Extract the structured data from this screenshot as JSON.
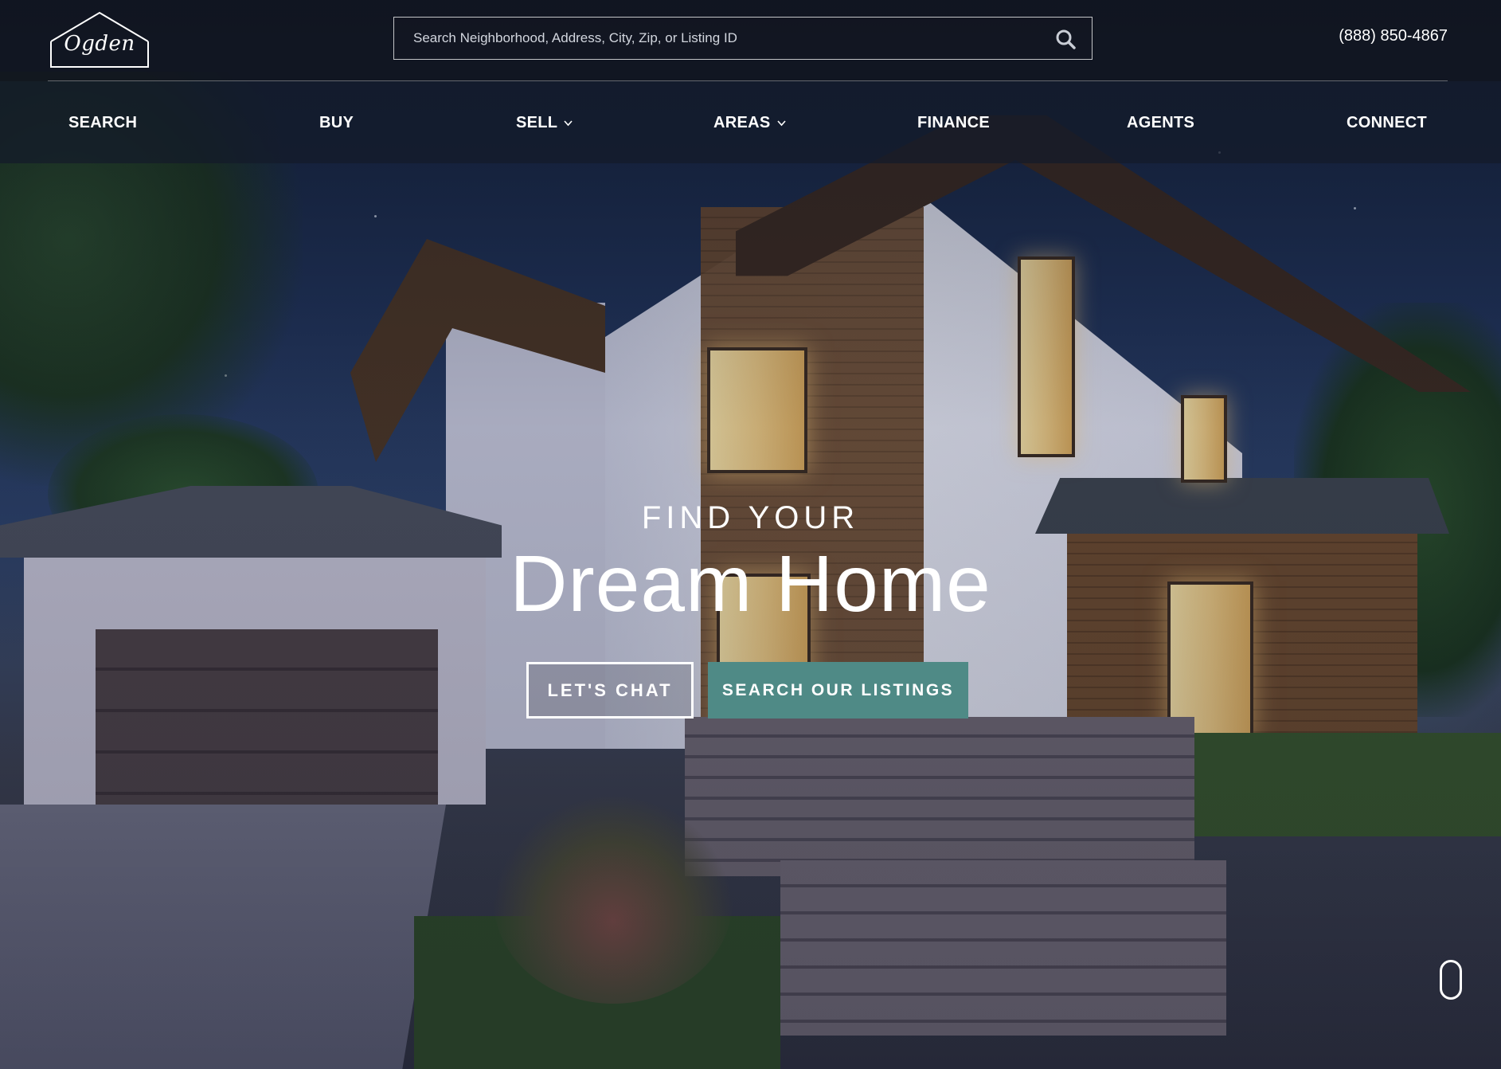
{
  "header": {
    "logo_text": "Ogden",
    "search": {
      "placeholder": "Search Neighborhood, Address, City, Zip, or Listing ID"
    },
    "phone": "(888) 850-4867"
  },
  "nav": {
    "items": [
      {
        "label": "SEARCH",
        "has_dropdown": false
      },
      {
        "label": "BUY",
        "has_dropdown": false
      },
      {
        "label": "SELL",
        "has_dropdown": true
      },
      {
        "label": "AREAS",
        "has_dropdown": true
      },
      {
        "label": "FINANCE",
        "has_dropdown": false
      },
      {
        "label": "AGENTS",
        "has_dropdown": false
      },
      {
        "label": "CONNECT",
        "has_dropdown": false
      }
    ]
  },
  "hero": {
    "kicker": "FIND YOUR",
    "headline": "Dream Home",
    "primary_button": "LET'S CHAT",
    "secondary_button": "SEARCH OUR LISTINGS"
  },
  "colors": {
    "accent": "#4f8a86",
    "header_bg": "#11151e",
    "text": "#ffffff"
  },
  "icons": {
    "logo": "house-outline-logo",
    "search": "search-icon",
    "dropdown": "chevron-down-icon",
    "scroll": "mouse-scroll-icon"
  }
}
